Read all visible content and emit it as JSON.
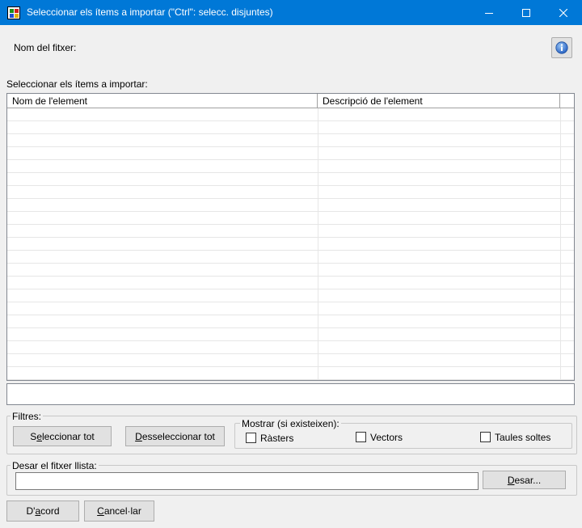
{
  "window": {
    "title": "Seleccionar els ítems a importar (\"Ctrl\": selecc. disjuntes)"
  },
  "file": {
    "label": "Nom del fitxer:"
  },
  "items": {
    "section_label": "Seleccionar els ítems a importar:",
    "columns": [
      "Nom de l'element",
      "Descripció de l'element"
    ],
    "rows": []
  },
  "filters": {
    "group_label": "Filtres:",
    "select_all_pre": "S",
    "select_all_acc": "e",
    "select_all_post": "leccionar tot",
    "deselect_all_pre": "",
    "deselect_all_acc": "D",
    "deselect_all_post": "esseleccionar tot"
  },
  "show": {
    "group_label": "Mostrar (si existeixen):",
    "rasters": {
      "label": "Ràsters",
      "checked": false
    },
    "vectors": {
      "label": "Vectors",
      "checked": false
    },
    "tables": {
      "label": "Taules soltes",
      "checked": false
    }
  },
  "save_list": {
    "group_label": "Desar el fitxer llista:",
    "path_value": "",
    "save_button_acc": "D",
    "save_button_post": "esar..."
  },
  "footer": {
    "ok_pre": "D'",
    "ok_acc": "a",
    "ok_post": "cord",
    "cancel_pre": "",
    "cancel_acc": "C",
    "cancel_post": "ancel·lar"
  }
}
